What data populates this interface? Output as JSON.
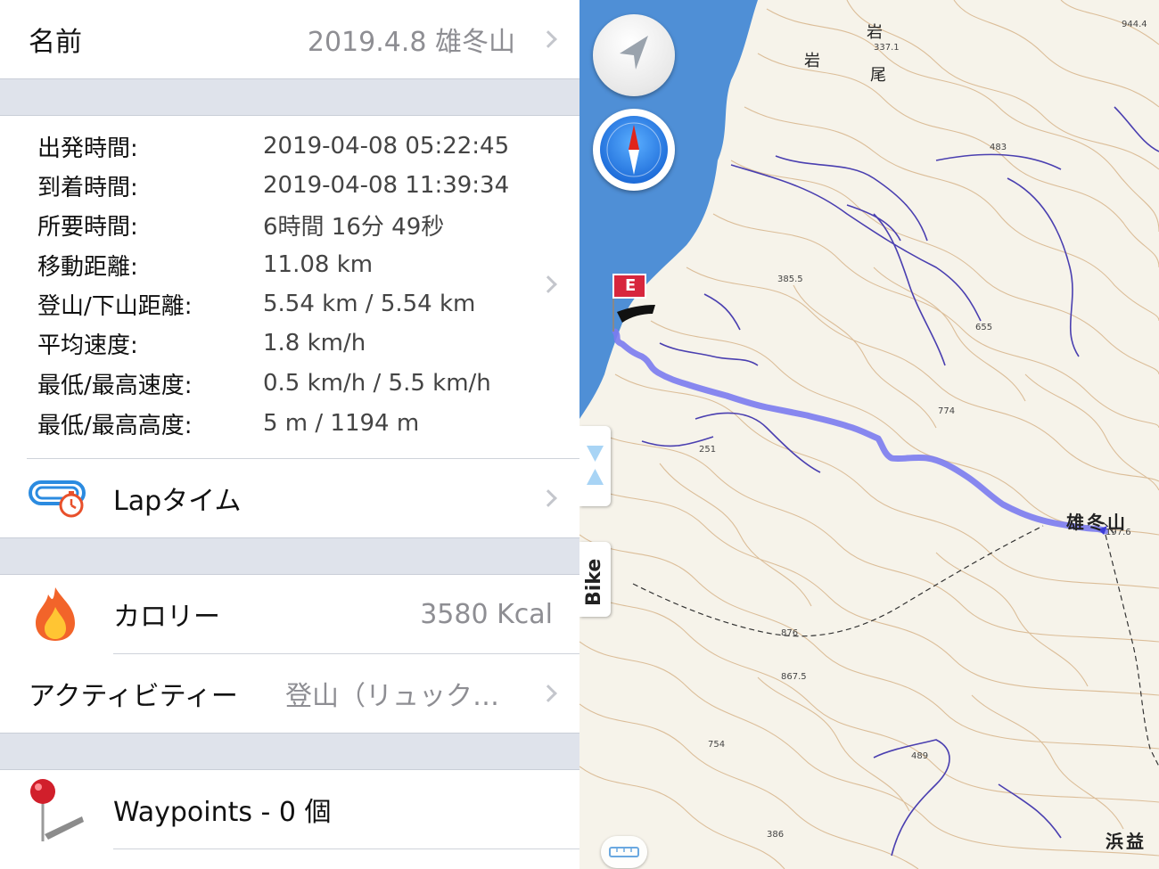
{
  "name_row": {
    "label": "名前",
    "value": "2019.4.8 雄冬山"
  },
  "stats": [
    {
      "key": "出発時間:",
      "value": "2019-04-08 05:22:45"
    },
    {
      "key": "到着時間:",
      "value": "2019-04-08 11:39:34"
    },
    {
      "key": "所要時間:",
      "value": "6時間 16分 49秒"
    },
    {
      "key": "移動距離:",
      "value": "11.08 km"
    },
    {
      "key": "登山/下山距離:",
      "value": "5.54 km / 5.54 km"
    },
    {
      "key": "平均速度:",
      "value": "1.8 km/h"
    },
    {
      "key": "最低/最高速度:",
      "value": "0.5 km/h / 5.5 km/h"
    },
    {
      "key": "最低/最高高度:",
      "value": "5 m / 1194 m"
    }
  ],
  "lap_row": {
    "label": "Lapタイム",
    "icon": "lap-timer-icon"
  },
  "calorie_row": {
    "label": "カロリー",
    "value": "3580 Kcal",
    "icon": "flame-icon"
  },
  "activity_row": {
    "label": "アクティビティー",
    "value": "登山（リュック…"
  },
  "waypoints_row": {
    "label": "Waypoints - 0 個",
    "icon": "pin-icon"
  },
  "map": {
    "bike_label": "Bike",
    "end_flag": "E",
    "summit_label": "雄冬山",
    "place_labels": [
      "岩",
      "岩",
      "尾",
      "浜益"
    ],
    "elevations": [
      "944.4",
      "337.1",
      "483",
      "385.5",
      "655",
      "774",
      "251",
      "197.6",
      "876",
      "867.5",
      "754",
      "489",
      "386"
    ],
    "colors": {
      "track": "#7b7bf0",
      "river": "#4a3fb0",
      "sea": "#4f8fd6",
      "accent_red": "#d7263d"
    }
  }
}
